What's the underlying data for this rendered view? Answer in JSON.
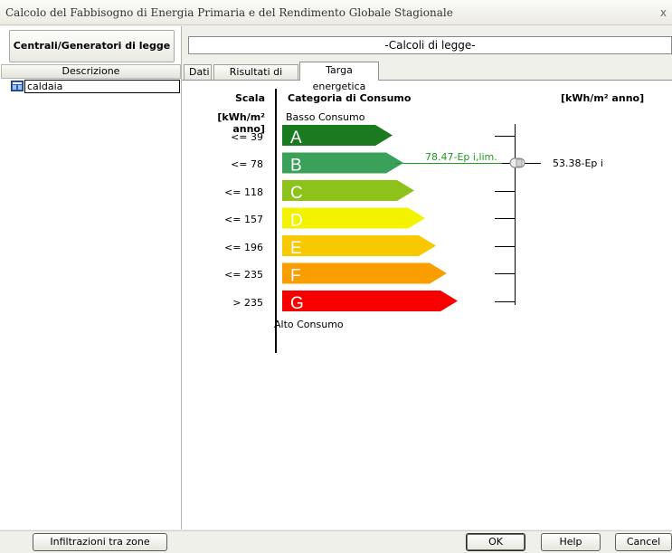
{
  "window": {
    "title": "Calcolo del Fabbisogno di Energia Primaria e del Rendimento Globale Stagionale",
    "close": "x"
  },
  "left": {
    "header": "Centrali/Generatori di legge",
    "column": "Descrizione",
    "items": [
      {
        "label": "caldaia",
        "icon": "boiler-icon"
      }
    ]
  },
  "right": {
    "header": "-Calcoli di legge-",
    "tabs": [
      {
        "label": "Dati",
        "active": false
      },
      {
        "label": "Risultati di calcolo",
        "active": false
      },
      {
        "label": "Targa energetica",
        "active": true
      }
    ]
  },
  "energy": {
    "scale_title": "Scala",
    "scale_unit": "[kWh/m² anno]",
    "category_title": "Categoria di Consumo",
    "unit_right": "[kWh/m² anno]",
    "top_label": "Basso Consumo",
    "bottom_label": "Alto Consumo",
    "classes": [
      {
        "letter": "A",
        "threshold": "<= 39",
        "color": "#1a7a1f"
      },
      {
        "letter": "B",
        "threshold": "<= 78",
        "color": "#3aa05a"
      },
      {
        "letter": "C",
        "threshold": "<= 118",
        "color": "#8cc21a"
      },
      {
        "letter": "D",
        "threshold": "<= 157",
        "color": "#f3f300"
      },
      {
        "letter": "E",
        "threshold": "<= 196",
        "color": "#f8c800"
      },
      {
        "letter": "F",
        "threshold": "<= 235",
        "color": "#fa9e00"
      },
      {
        "letter": "G",
        "threshold": "> 235",
        "color": "#f80000"
      }
    ],
    "limit_label": "78.47-Ep i,lim.",
    "limit_color": "#1e9e1e",
    "value_label": "53.38-Ep i"
  },
  "footer": {
    "infiltration_button": "Infiltrazioni tra zone",
    "ok_button": "OK",
    "help_button": "Help",
    "cancel_button": "Cancel"
  }
}
